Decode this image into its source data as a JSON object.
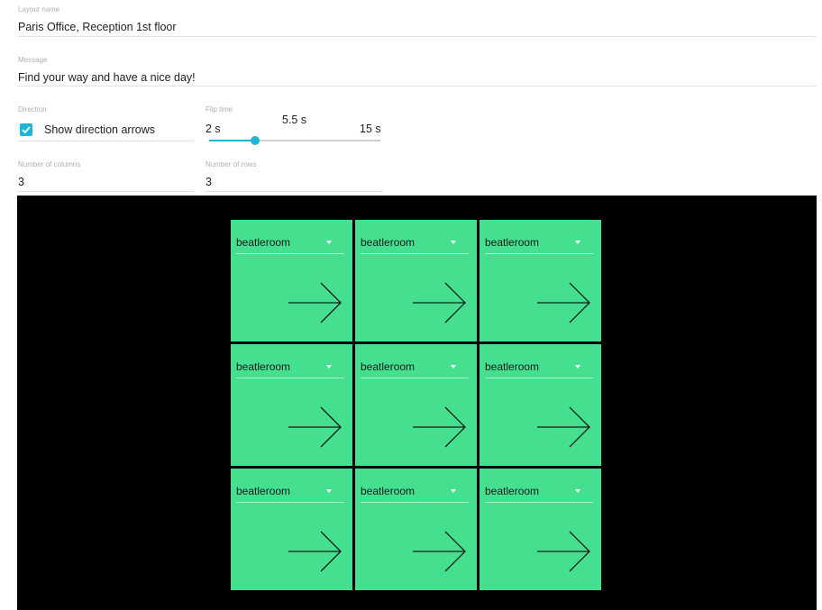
{
  "form": {
    "layout_name_label": "Layout name",
    "layout_name_value": "Paris Office, Reception 1st floor",
    "message_label": "Message",
    "message_value": "Find your way and have a nice day!",
    "direction_label": "Direction",
    "show_arrows_label": "Show direction arrows",
    "show_arrows_checked": true,
    "flip_time_label": "Flip time",
    "flip_min": "2 s",
    "flip_current": "5.5 s",
    "flip_max": "15 s",
    "flip_value": 5.5,
    "flip_min_value": 2,
    "flip_max_value": 15,
    "columns_label": "Number of columns",
    "columns_value": "3",
    "rows_label": "Number of rows",
    "rows_value": "3"
  },
  "preview": {
    "background": "#000000",
    "tile_color": "#45df90",
    "accent": "#1fb6d6",
    "tiles": [
      {
        "room": "beatleroom",
        "arrow": "arrow-right-icon"
      },
      {
        "room": "beatleroom",
        "arrow": "arrow-right-icon"
      },
      {
        "room": "beatleroom",
        "arrow": "arrow-right-icon"
      },
      {
        "room": "beatleroom",
        "arrow": "arrow-right-icon"
      },
      {
        "room": "beatleroom",
        "arrow": "arrow-right-icon"
      },
      {
        "room": "beatleroom",
        "arrow": "arrow-right-icon"
      },
      {
        "room": "beatleroom",
        "arrow": "arrow-right-icon"
      },
      {
        "room": "beatleroom",
        "arrow": "arrow-right-icon"
      },
      {
        "room": "beatleroom",
        "arrow": "arrow-right-icon"
      }
    ]
  }
}
